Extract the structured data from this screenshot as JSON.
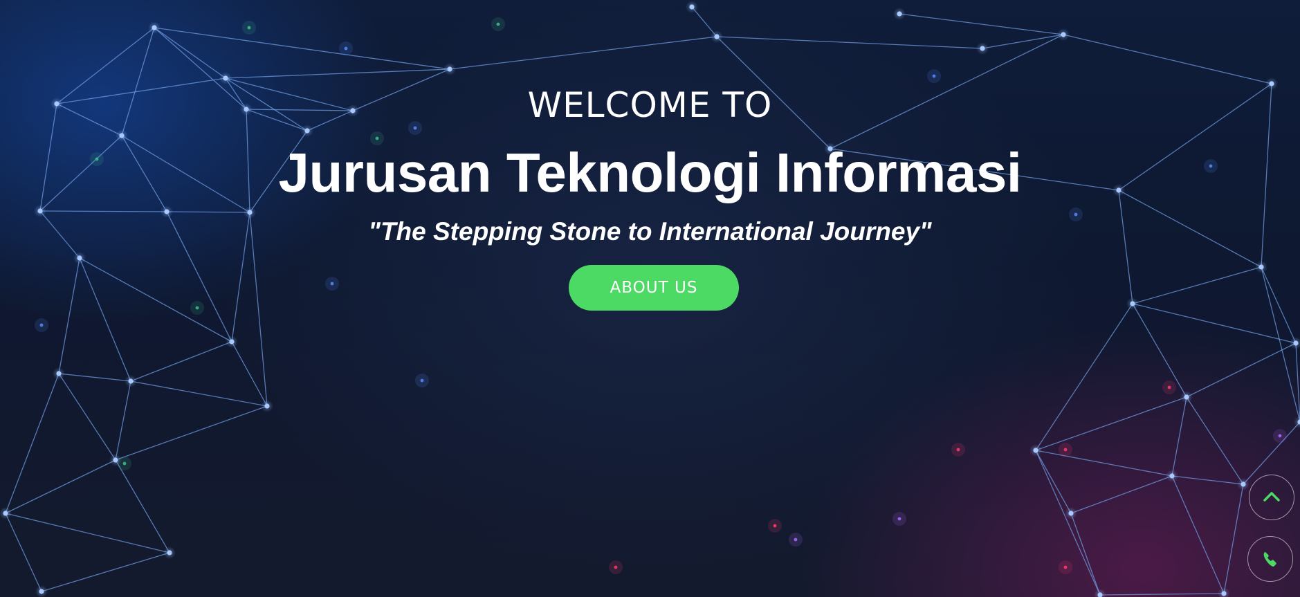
{
  "hero": {
    "welcome_text": "WELCOME TO",
    "title": "Jurusan Teknologi Informasi",
    "tagline": "\"The Stepping Stone to International Journey\"",
    "cta_label": "ABOUT US"
  },
  "floating_buttons": {
    "scroll_top_icon": "chevron-up-icon",
    "call_icon": "phone-icon"
  },
  "colors": {
    "accent": "#4cd964",
    "background_dark": "#0d1526",
    "network_lines": "#6f9be0",
    "glow_magenta": "#78195a"
  }
}
